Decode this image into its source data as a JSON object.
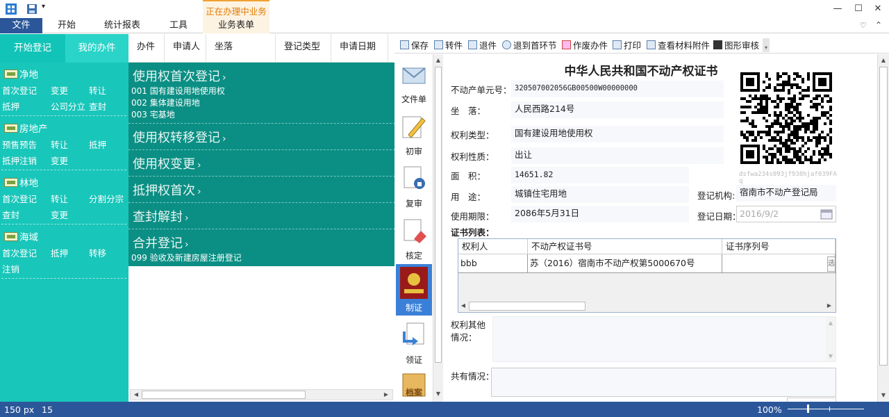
{
  "window": {
    "context_tab_group": "正在办理中业务",
    "ribbon_tabs": [
      "文件",
      "开始",
      "统计报表",
      "工具",
      "业务表单"
    ]
  },
  "left_nav": {
    "tabs": [
      "开始登记",
      "我的办件"
    ],
    "categories": [
      {
        "title": "净地",
        "items": [
          "首次登记",
          "变更",
          "转让",
          "抵押",
          "公司分立",
          "查封"
        ]
      },
      {
        "title": "房地产",
        "items": [
          "预售预告",
          "转让",
          "抵押",
          "抵押注销",
          "变更"
        ]
      },
      {
        "title": "林地",
        "items": [
          "首次登记",
          "转让",
          "分割分宗",
          "查封",
          "变更"
        ]
      },
      {
        "title": "海域",
        "items": [
          "首次登记",
          "抵押",
          "转移",
          "注销"
        ]
      }
    ]
  },
  "grid_columns": [
    "办件",
    "申请人",
    "坐落",
    "登记类型",
    "申请日期"
  ],
  "popup_menu": {
    "groups": [
      {
        "title": "使用权首次登记",
        "items": [
          "001 国有建设用地使用权",
          "002 集体建设用地",
          "003 宅基地"
        ]
      },
      {
        "title": "使用权转移登记",
        "items": []
      },
      {
        "title": "使用权变更",
        "items": []
      },
      {
        "title": "抵押权首次",
        "items": []
      },
      {
        "title": "查封解封",
        "items": []
      },
      {
        "title": "合并登记",
        "items": [
          "099 验收及新建房屋注册登记"
        ]
      }
    ]
  },
  "toolbar": {
    "buttons": [
      "保存",
      "转件",
      "退件",
      "退到首环节",
      "作废办件",
      "打印",
      "查看材料附件",
      "图形审核"
    ]
  },
  "workflow_steps": [
    "文件单",
    "初审",
    "复审",
    "核定",
    "制证",
    "领证",
    "档案"
  ],
  "certificate": {
    "title": "中华人民共和国不动产权证书",
    "unit_no_label": "不动产单元号：",
    "unit_no": "320507002056GB00500W00000000",
    "location_label": "坐　落：",
    "location": "人民西路214号",
    "right_type_label": "权利类型：",
    "right_type": "国有建设用地使用权",
    "right_nature_label": "权利性质：",
    "right_nature": "出让",
    "area_label": "面　积：",
    "area": "14651.82",
    "usage_label": "用　途：",
    "usage": "城镇住宅用地",
    "org_label": "登记机构:",
    "org": "宿南市不动产登记局",
    "term_label": "使用期限：",
    "term": "2086年5月31日",
    "date_label": "登记日期：",
    "date": "2016/9/2",
    "qr_code_text": "dsfwa234s093jf938hjaf039FA",
    "qr_code_text_tail": "q",
    "cert_list_label": "证书列表：",
    "cert_table": {
      "headers": [
        "权利人",
        "不动产权证书号",
        "证书序列号"
      ],
      "rows": [
        [
          "bbb",
          "苏（2016）宿南市不动产权第5000670号",
          ""
        ]
      ],
      "row_button_glyph": "选"
    },
    "other_rights_label_1": "权利其他",
    "other_rights_label_2": "情况：",
    "shared_label": "共有情况："
  },
  "status": {
    "left_1": "150 px",
    "left_2": "15",
    "zoom": "100%"
  }
}
